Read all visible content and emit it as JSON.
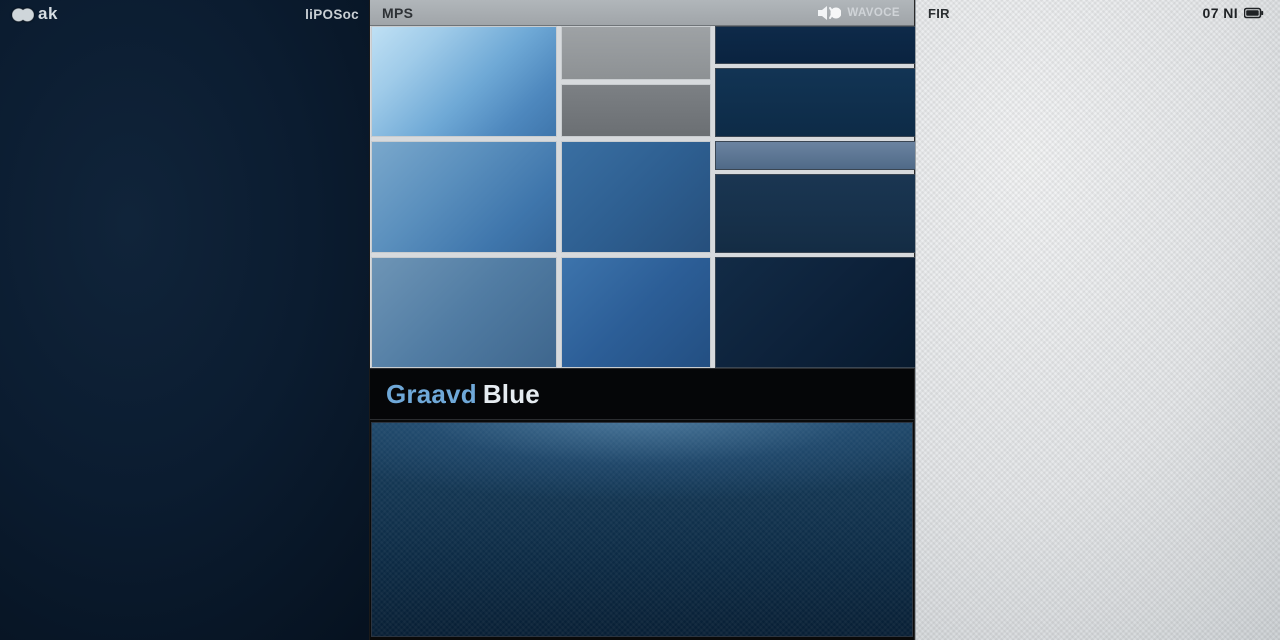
{
  "left": {
    "brand": "ak",
    "header_right": "liPOSoc"
  },
  "center": {
    "header_left": "MPS",
    "header_right": "WAVOCE",
    "selected": {
      "word1": "Graavd",
      "word2": "Blue"
    },
    "swatches": {
      "row1": {
        "a": "#6fa9d6",
        "b_top": "#8d9194",
        "b_bottom": "#6b6f73",
        "c_top": "#0a2340",
        "c_bottom": "#0d2b47"
      },
      "row2": {
        "a": "#3f76ac",
        "b": "#264f7c",
        "c_top": "#506a88",
        "c_bottom": "#142c44"
      },
      "row3": {
        "a": "#3e668d",
        "b": "#234f82",
        "c": "#081a2e"
      }
    }
  },
  "right": {
    "header_left": "FIR",
    "header_right": "07 NI"
  }
}
